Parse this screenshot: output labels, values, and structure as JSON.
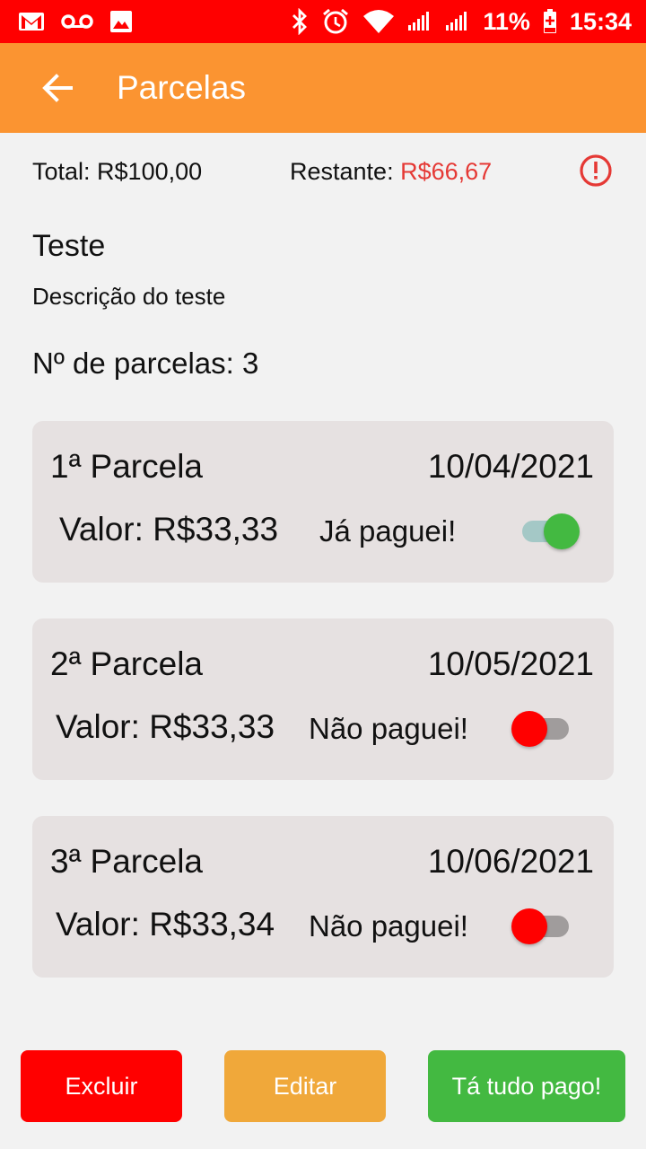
{
  "status_bar": {
    "battery": "11%",
    "time": "15:34",
    "icons": [
      "gmail-icon",
      "voicemail-icon",
      "image-icon",
      "bluetooth-icon",
      "alarm-icon",
      "wifi-icon",
      "signal-icon",
      "signal-icon",
      "battery-charging-icon"
    ]
  },
  "app_bar": {
    "title": "Parcelas",
    "back_icon": "arrow-back-icon"
  },
  "summary": {
    "total_label": "Total: R$100,00",
    "restante_label": "Restante: ",
    "restante_value": "R$66,67",
    "alert_icon": "alert-circle-icon"
  },
  "item": {
    "title": "Teste",
    "description": "Descrição do teste",
    "count_label": "Nº de parcelas: 3"
  },
  "installments": [
    {
      "label": "1ª Parcela",
      "date": "10/04/2021",
      "valor": "Valor: R$33,33",
      "status": "Já paguei!",
      "paid": true
    },
    {
      "label": "2ª Parcela",
      "date": "10/05/2021",
      "valor": "Valor: R$33,33",
      "status": "Não paguei!",
      "paid": false
    },
    {
      "label": "3ª Parcela",
      "date": "10/06/2021",
      "valor": "Valor: R$33,34",
      "status": "Não paguei!",
      "paid": false
    }
  ],
  "buttons": {
    "delete": "Excluir",
    "edit": "Editar",
    "all_paid": "Tá tudo pago!"
  },
  "colors": {
    "status_bar": "#ff0000",
    "app_bar": "#fb9431",
    "card": "#e6e1e1",
    "remaining_red": "#e53935",
    "switch_on": "#43b941",
    "switch_off": "#ff0000",
    "delete_button": "#ff0000",
    "edit_button": "#f0a83a",
    "all_paid_button": "#43b941"
  }
}
